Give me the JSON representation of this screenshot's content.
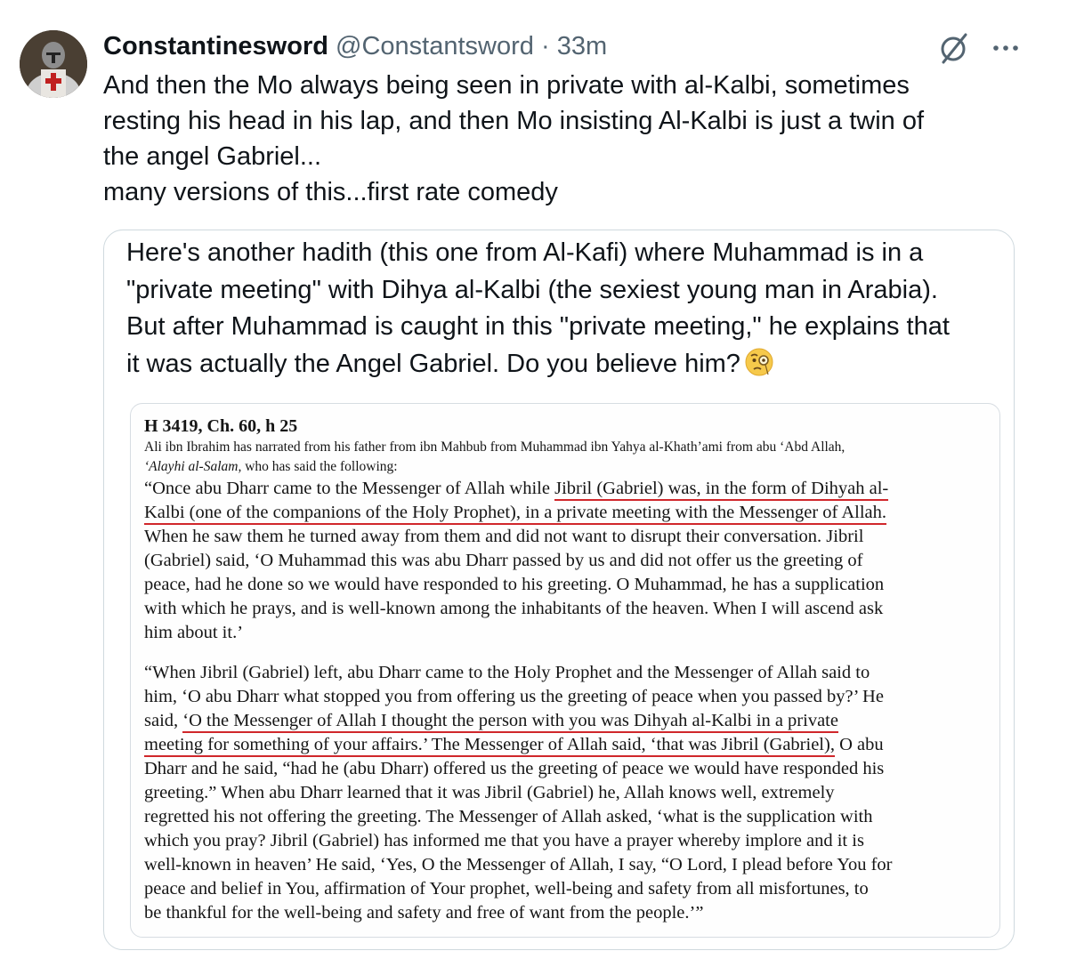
{
  "tweet": {
    "display_name": "Constantinesword",
    "handle": "@Constantsword",
    "separator": "·",
    "time": "33m",
    "text_lines": [
      "And then the Mo always being seen in private with al-Kalbi, sometimes",
      "resting his head in his lap, and then Mo insisting Al-Kalbi is just a twin of",
      "the angel Gabriel...",
      "many versions of this...first rate comedy"
    ],
    "icons": {
      "avatar": "knight-avatar",
      "grok": "grok-icon",
      "more": "more-icon"
    }
  },
  "quote": {
    "text_lines": [
      "Here's another hadith (this one from Al-Kafi) where Muhammad is in a",
      "\"private meeting\" with Dihya al-Kalbi (the sexiest young man in Arabia).",
      "But after Muhammad is caught in this \"private meeting,\" he explains that",
      "it was actually the Angel Gabriel. Do you believe him?"
    ],
    "emoji": "face-with-monocle"
  },
  "document": {
    "title": "H 3419, Ch. 60, h 25",
    "chain_line1": "Ali ibn Ibrahim has narrated from his father from ibn Mahbub from Muhammad ibn Yahya al-Khath’ami from abu ‘Abd Allah,",
    "chain_line2_italic": "‘Alayhi al-Salam,",
    "chain_line2_rest": " who has said the following:",
    "p1": {
      "l1_a": "“Once abu Dharr came to the Messenger of Allah while ",
      "l1_b": "Jibril (Gabriel) was, in the form of Dihyah al-",
      "l2": "Kalbi (one of the companions of the Holy Prophet), in a private meeting with the Messenger of Allah.",
      "l3": "When he saw them he turned away from them and did not want to disrupt their conversation. Jibril",
      "l4": "(Gabriel) said, ‘O Muhammad this was abu Dharr passed by us and did not offer us the greeting of",
      "l5": "peace, had he done so we would have responded to his greeting. O Muhammad, he has a supplication",
      "l6": "with which he prays, and is well-known among the inhabitants of the heaven. When I will ascend ask",
      "l7": "him about it.’"
    },
    "p2": {
      "l1": "“When Jibril (Gabriel) left, abu Dharr came to the Holy Prophet and the Messenger of Allah said to",
      "l2": "him, ‘O abu Dharr what stopped you from offering us the greeting of peace when you passed by?’ He",
      "l3_a": "said, ",
      "l3_b": "‘O the Messenger of Allah I thought the person with you was Dihyah al-Kalbi in a private",
      "l4_a": "meeting for something of your affairs.’ The Messenger of Allah said, ‘that was Jibril (Gabriel),",
      "l4_b": " O abu",
      "l5": "Dharr and he said, “had he (abu Dharr) offered us the greeting of peace we would have responded his",
      "l6": "greeting.” When abu Dharr learned that it was Jibril (Gabriel) he, Allah knows well, extremely",
      "l7": "regretted his not offering the greeting. The Messenger of Allah asked, ‘what is the supplication with",
      "l8": "which you pray? Jibril (Gabriel) has informed me that you have a prayer whereby implore and it is",
      "l9": "well-known in heaven’ He said, ‘Yes, O the Messenger of Allah, I say, “O Lord, I plead before You for",
      "l10": "peace and belief in You, affirmation of Your prophet, well-being and safety from all misfortunes, to",
      "l11": "be thankful for the well-being and safety and free of want from the people.’”"
    }
  },
  "colors": {
    "underline": "#d0272b",
    "muted": "#536471",
    "border": "#cfd9de"
  }
}
